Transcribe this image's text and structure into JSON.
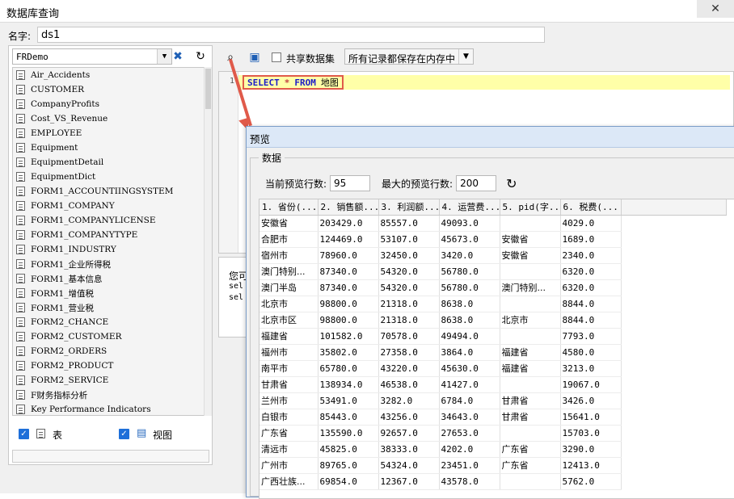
{
  "window": {
    "title": "数据库查询",
    "close": "✕"
  },
  "name_row": {
    "label": "名字:",
    "value": "ds1"
  },
  "left": {
    "connection": "FRDemo",
    "tables": [
      "Air_Accidents",
      "CUSTOMER",
      "CompanyProfits",
      "Cost_VS_Revenue",
      "EMPLOYEE",
      "Equipment",
      "EquipmentDetail",
      "EquipmentDict",
      "FORM1_ACCOUNTIINGSYSTEM",
      "FORM1_COMPANY",
      "FORM1_COMPANYLICENSE",
      "FORM1_COMPANYTYPE",
      "FORM1_INDUSTRY",
      "FORM1_企业所得税",
      "FORM1_基本信息",
      "FORM1_增值税",
      "FORM1_营业税",
      "FORM2_CHANCE",
      "FORM2_CUSTOMER",
      "FORM2_ORDERS",
      "FORM2_PRODUCT",
      "FORM2_SERVICE",
      "F财务指标分析",
      "Key Performance Indicators"
    ],
    "check_table": "表",
    "check_view": "视图"
  },
  "toolbar": {
    "share_label": "共享数据集",
    "memory_option": "所有记录都保存在内存中"
  },
  "editor": {
    "line_no": "1",
    "kw_select": "SELECT",
    "star": "*",
    "kw_from": "FROM",
    "table": "地图"
  },
  "info": {
    "line1": "您可",
    "line2": "sel",
    "line3": "sel"
  },
  "preview": {
    "title": "预览",
    "group": "数据",
    "current_rows_label": "当前预览行数:",
    "current_rows": "95",
    "max_rows_label": "最大的预览行数:",
    "max_rows": "200",
    "columns": [
      "1. 省份(...",
      "2. 销售额...",
      "3. 利润额...",
      "4. 运营费...",
      "5. pid(字...",
      "6. 税费(..."
    ],
    "rows": [
      [
        "安徽省",
        "203429.0",
        "85557.0",
        "49093.0",
        "",
        "4029.0"
      ],
      [
        "合肥市",
        "124469.0",
        "53107.0",
        "45673.0",
        "安徽省",
        "1689.0"
      ],
      [
        "宿州市",
        "78960.0",
        "32450.0",
        "3420.0",
        "安徽省",
        "2340.0"
      ],
      [
        "澳门特别...",
        "87340.0",
        "54320.0",
        "56780.0",
        "",
        "6320.0"
      ],
      [
        "澳门半岛",
        "87340.0",
        "54320.0",
        "56780.0",
        "澳门特别...",
        "6320.0"
      ],
      [
        "北京市",
        "98800.0",
        "21318.0",
        "8638.0",
        "",
        "8844.0"
      ],
      [
        "北京市区",
        "98800.0",
        "21318.0",
        "8638.0",
        "北京市",
        "8844.0"
      ],
      [
        "福建省",
        "101582.0",
        "70578.0",
        "49494.0",
        "",
        "7793.0"
      ],
      [
        "福州市",
        "35802.0",
        "27358.0",
        "3864.0",
        "福建省",
        "4580.0"
      ],
      [
        "南平市",
        "65780.0",
        "43220.0",
        "45630.0",
        "福建省",
        "3213.0"
      ],
      [
        "甘肃省",
        "138934.0",
        "46538.0",
        "41427.0",
        "",
        "19067.0"
      ],
      [
        "兰州市",
        "53491.0",
        "3282.0",
        "6784.0",
        "甘肃省",
        "3426.0"
      ],
      [
        "白银市",
        "85443.0",
        "43256.0",
        "34643.0",
        "甘肃省",
        "15641.0"
      ],
      [
        "广东省",
        "135590.0",
        "92657.0",
        "27653.0",
        "",
        "15703.0"
      ],
      [
        "清远市",
        "45825.0",
        "38333.0",
        "4202.0",
        "广东省",
        "3290.0"
      ],
      [
        "广州市",
        "89765.0",
        "54324.0",
        "23451.0",
        "广东省",
        "12413.0"
      ],
      [
        "广西壮族...",
        "69854.0",
        "12367.0",
        "43578.0",
        "",
        "5762.0"
      ]
    ]
  }
}
